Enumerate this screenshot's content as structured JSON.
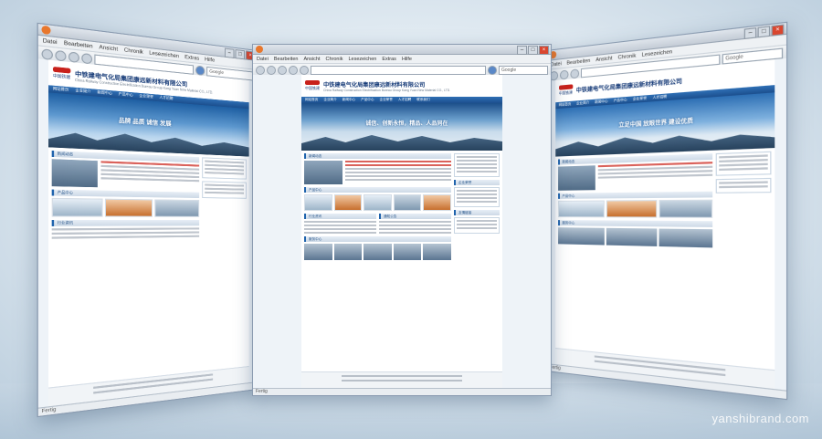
{
  "browser": {
    "menu": [
      "Datei",
      "Bearbeiten",
      "Ansicht",
      "Chronik",
      "Lesezeichen",
      "Extras",
      "Hilfe"
    ],
    "search_placeholder": "Google",
    "status": "Fertig"
  },
  "site": {
    "company_name": "中铁建电气化局集团康远新材料有限公司",
    "company_en": "China Railway Construction Electrification Bureau Group Kang Yuan New Material CO., LTD.",
    "logo_text": "中国铁建",
    "slogan": "诚信、创新永恒，精品、人品同在",
    "left_slogan": "品牌 品质 诚信 发展",
    "right_slogan": "立足中国 放眼世界 建设优质",
    "nav": [
      "网站首页",
      "企业简介",
      "新闻中心",
      "产品中心",
      "企业荣誉",
      "人才招聘",
      "联系我们"
    ],
    "sections": {
      "news": "新闻动态",
      "products": "产品中心",
      "industry": "行业资讯",
      "notice": "通知公告",
      "links": "友情链接",
      "honor": "企业荣誉",
      "service": "服务中心"
    },
    "footer_brand": "中国铁建"
  },
  "watermark": "yanshibrand.com"
}
